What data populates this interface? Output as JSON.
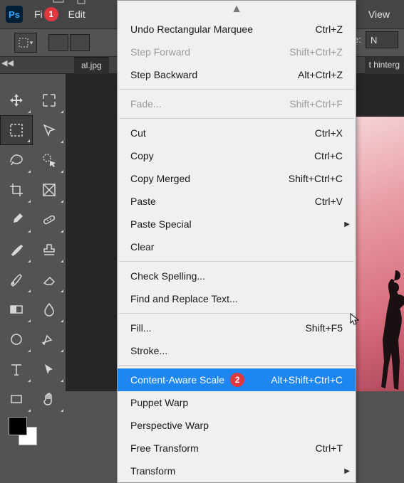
{
  "app": {
    "logo": "Ps"
  },
  "menubar": {
    "file_label": "Fi",
    "file_badge": "1",
    "edit_label": "Edit",
    "view_label": "View"
  },
  "optionsbar": {
    "style_label": "Style:",
    "style_value": "N"
  },
  "doc": {
    "tab_left": "al.jpg",
    "tab_right": "t hinterg"
  },
  "edit_menu": {
    "undo": {
      "label": "Undo Rectangular Marquee",
      "shortcut": "Ctrl+Z"
    },
    "step_forward": {
      "label": "Step Forward",
      "shortcut": "Shift+Ctrl+Z"
    },
    "step_backward": {
      "label": "Step Backward",
      "shortcut": "Alt+Ctrl+Z"
    },
    "fade": {
      "label": "Fade...",
      "shortcut": "Shift+Ctrl+F"
    },
    "cut": {
      "label": "Cut",
      "shortcut": "Ctrl+X"
    },
    "copy": {
      "label": "Copy",
      "shortcut": "Ctrl+C"
    },
    "copy_merged": {
      "label": "Copy Merged",
      "shortcut": "Shift+Ctrl+C"
    },
    "paste": {
      "label": "Paste",
      "shortcut": "Ctrl+V"
    },
    "paste_special": {
      "label": "Paste Special"
    },
    "clear": {
      "label": "Clear"
    },
    "check_spelling": {
      "label": "Check Spelling..."
    },
    "find_replace": {
      "label": "Find and Replace Text..."
    },
    "fill": {
      "label": "Fill...",
      "shortcut": "Shift+F5"
    },
    "stroke": {
      "label": "Stroke..."
    },
    "content_aware_scale": {
      "label": "Content-Aware Scale",
      "shortcut": "Alt+Shift+Ctrl+C",
      "badge": "2"
    },
    "puppet_warp": {
      "label": "Puppet Warp"
    },
    "perspective_warp": {
      "label": "Perspective Warp"
    },
    "free_transform": {
      "label": "Free Transform",
      "shortcut": "Ctrl+T"
    },
    "transform": {
      "label": "Transform"
    }
  }
}
